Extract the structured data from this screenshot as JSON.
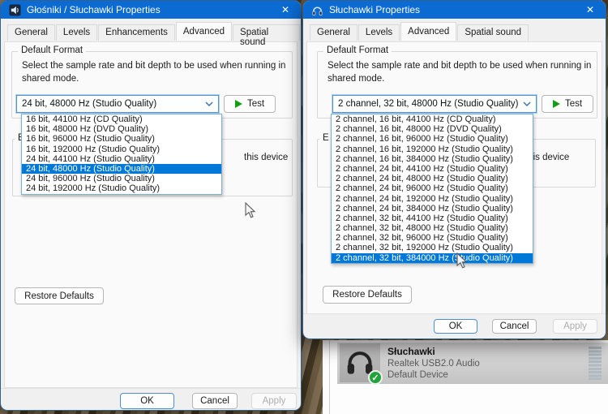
{
  "colors": {
    "titlebar": "#0b6bd3",
    "selection": "#0078d7",
    "test_play": "#169c16",
    "badge_green": "#23a33c"
  },
  "left_dialog": {
    "title": "Głośniki / Słuchawki Properties",
    "close_glyph": "✕",
    "tabs": [
      {
        "label": "General"
      },
      {
        "label": "Levels"
      },
      {
        "label": "Enhancements"
      },
      {
        "label": "Advanced",
        "selected": true
      },
      {
        "label": "Spatial sound"
      }
    ],
    "default_format": {
      "group_label": "Default Format",
      "description": "Select the sample rate and bit depth to be used when running in shared mode.",
      "combo_value": "24 bit, 48000 Hz (Studio Quality)",
      "test_label": "Test",
      "options": [
        {
          "label": "16 bit, 44100 Hz (CD Quality)"
        },
        {
          "label": "16 bit, 48000 Hz (DVD Quality)"
        },
        {
          "label": "16 bit, 96000 Hz (Studio Quality)"
        },
        {
          "label": "16 bit, 192000 Hz (Studio Quality)"
        },
        {
          "label": "24 bit, 44100 Hz (Studio Quality)"
        },
        {
          "label": "24 bit, 48000 Hz (Studio Quality)",
          "selected": true
        },
        {
          "label": "24 bit, 96000 Hz (Studio Quality)"
        },
        {
          "label": "24 bit, 192000 Hz (Studio Quality)"
        }
      ]
    },
    "exclusive_mode": {
      "legend_fragment": "E",
      "visible_text_fragment": "this device"
    },
    "restore_defaults_label": "Restore Defaults",
    "buttons": {
      "ok": "OK",
      "cancel": "Cancel",
      "apply": "Apply"
    }
  },
  "right_dialog": {
    "title": "Słuchawki Properties",
    "close_glyph": "✕",
    "tabs": [
      {
        "label": "General"
      },
      {
        "label": "Levels"
      },
      {
        "label": "Advanced",
        "selected": true
      },
      {
        "label": "Spatial sound"
      }
    ],
    "default_format": {
      "group_label": "Default Format",
      "description": "Select the sample rate and bit depth to be used when running in shared mode.",
      "combo_value": "2 channel, 32 bit, 48000 Hz (Studio Quality)",
      "test_label": "Test",
      "options": [
        {
          "label": "2 channel, 16 bit, 44100 Hz (CD Quality)"
        },
        {
          "label": "2 channel, 16 bit, 48000 Hz (DVD Quality)"
        },
        {
          "label": "2 channel, 16 bit, 96000 Hz (Studio Quality)"
        },
        {
          "label": "2 channel, 16 bit, 192000 Hz (Studio Quality)"
        },
        {
          "label": "2 channel, 16 bit, 384000 Hz (Studio Quality)"
        },
        {
          "label": "2 channel, 24 bit, 44100 Hz (Studio Quality)"
        },
        {
          "label": "2 channel, 24 bit, 48000 Hz (Studio Quality)"
        },
        {
          "label": "2 channel, 24 bit, 96000 Hz (Studio Quality)"
        },
        {
          "label": "2 channel, 24 bit, 192000 Hz (Studio Quality)"
        },
        {
          "label": "2 channel, 24 bit, 384000 Hz (Studio Quality)"
        },
        {
          "label": "2 channel, 32 bit, 44100 Hz (Studio Quality)"
        },
        {
          "label": "2 channel, 32 bit, 48000 Hz (Studio Quality)"
        },
        {
          "label": "2 channel, 32 bit, 96000 Hz (Studio Quality)"
        },
        {
          "label": "2 channel, 32 bit, 192000 Hz (Studio Quality)"
        },
        {
          "label": "2 channel, 32 bit, 384000 Hz (Studio Quality)",
          "selected": true
        }
      ]
    },
    "exclusive_mode": {
      "legend_fragment": "E",
      "visible_text_fragment": "this device"
    },
    "restore_defaults_label": "Restore Defaults",
    "buttons": {
      "ok": "OK",
      "cancel": "Cancel",
      "apply": "Apply"
    }
  },
  "background_panel": {
    "device_name": "Słuchawki",
    "device_driver": "Realtek USB2.0 Audio",
    "device_status": "Default Device"
  }
}
